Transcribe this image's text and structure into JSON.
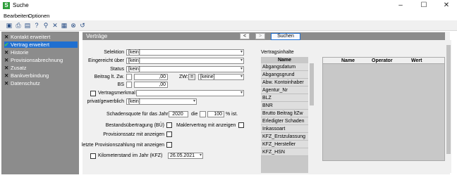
{
  "window": {
    "title": "Suche",
    "icon_letter": "S",
    "controls": [
      "–",
      "☐",
      "✕"
    ]
  },
  "menu": [
    "Bearbeiten",
    "Optionen"
  ],
  "toolbar_icons": [
    "save-icon",
    "print-icon",
    "print-preview-icon",
    "help-icon",
    "search-icon",
    "delete-icon",
    "calculator-icon",
    "cancel-icon",
    "reset-icon"
  ],
  "sidebar": {
    "items": [
      {
        "label": "Kontakt erweitert",
        "mark": "x",
        "active": false
      },
      {
        "label": "Vertrag erweitert",
        "mark": "check",
        "active": true
      },
      {
        "label": "Historie",
        "mark": "x",
        "active": false
      },
      {
        "label": "Provisionsabrechnung",
        "mark": "x",
        "active": false
      },
      {
        "label": "Zusatz",
        "mark": "x",
        "active": false
      },
      {
        "label": "Bankverbindung",
        "mark": "x",
        "active": false
      },
      {
        "label": "Datenschutz",
        "mark": "x",
        "active": false
      }
    ]
  },
  "header": {
    "title": "Verträge",
    "prev": "<",
    "next": ">",
    "search": "Suchen"
  },
  "form": {
    "selektion_label": "Selektion",
    "selektion_value": "[kein]",
    "eingereicht_label": "Eingereicht über",
    "eingereicht_value": "[kein]",
    "status_label": "Status",
    "status_value": "[kein]",
    "beitrag_label": "Beitrag lt. Zw.",
    "beitrag_value": ",00",
    "zw_label": "ZW:",
    "zw_op": "=",
    "zw_value": "[keine]",
    "bs_label": "BS",
    "bs_value": ",00",
    "vertragsmerkmal_label": "Vertragsmerkmal",
    "privat_label": "privat/gewerblich",
    "privat_value": "[kein]",
    "schadensquote_label": "Schadensquote für das Jahr",
    "schadensquote_year": "2020",
    "die_label": "die",
    "pct_value": "100",
    "pct_label": "% ist.",
    "bestand_label": "Bestandsübertragung (BÜ)",
    "makler_label": "Maklervertrag mit anzeigen",
    "provsatz_label": "Provisionssatz mit anzeigen",
    "letzte_label": "letzte Provisionszahlung mit anzeigen",
    "km_label": "Kilometerstand im Jahr (KFZ)",
    "km_date": "26.05.2021"
  },
  "vertragsinhalte": {
    "title": "Vertragsinhalte",
    "header": "Name",
    "items": [
      "Abgangsdatum",
      "Abgangsgrund",
      "Abw. Kontoinhaber",
      "Agentur_Nr",
      "BLZ",
      "BNR",
      "Brutto Beitrag ltZw",
      "Erledigter Schaden",
      "Inkassoart",
      "KFZ_Erstzulassung",
      "KFZ_Hersteller",
      "KFZ_HSN"
    ]
  },
  "criteria_grid": {
    "headers": [
      "Name",
      "Operator",
      "Wert"
    ]
  }
}
